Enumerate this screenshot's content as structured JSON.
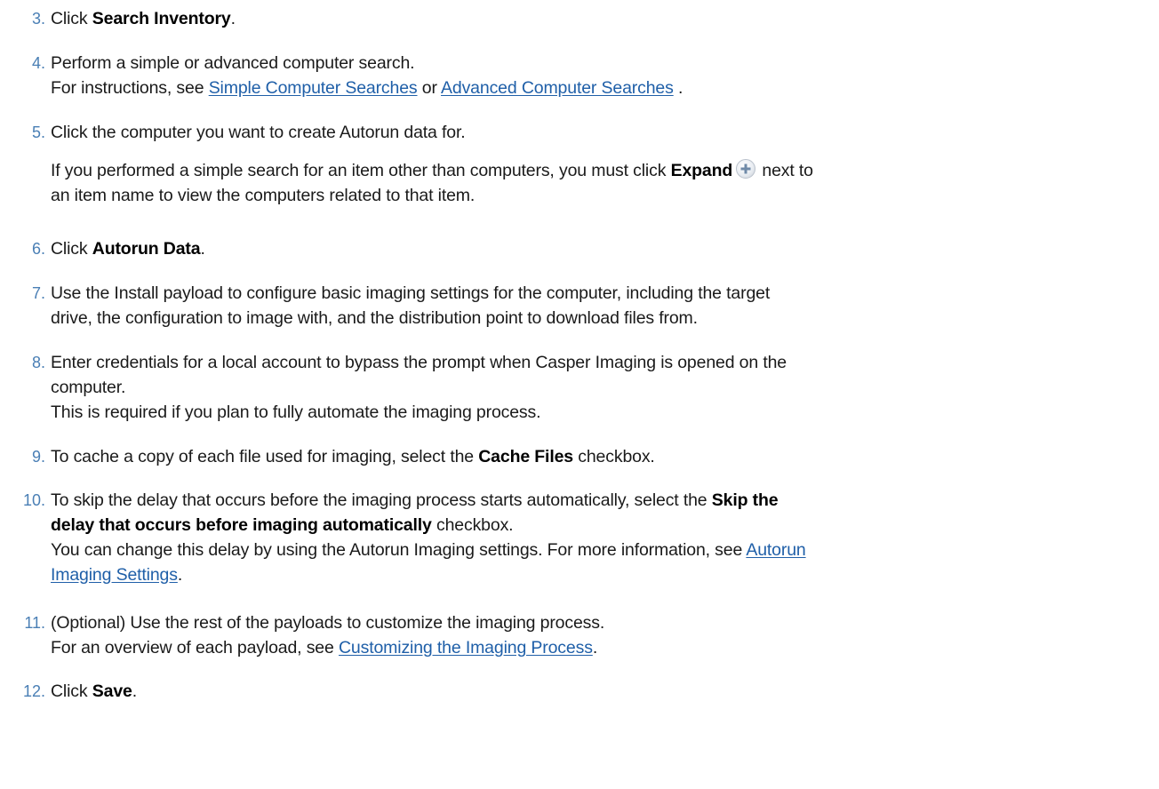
{
  "steps": [
    {
      "num": "3.",
      "pre": "Click ",
      "bold": "Search Inventory",
      "post": "."
    },
    {
      "num": "4.",
      "line1": "Perform a simple or advanced computer search.",
      "line2_pre": "For instructions, see ",
      "link1": "Simple Computer Searches",
      "line2_mid": " or ",
      "link2": "Advanced Computer Searches",
      "line2_post": " ."
    },
    {
      "num": "5.",
      "line1": "Click the computer you want to create Autorun data for.",
      "para_pre": "If you performed a simple search for an item other than computers, you must click ",
      "para_bold": "Expand",
      "para_post_1": " next to",
      "para_post_2": "an item name to view the computers related to that item."
    },
    {
      "num": "6.",
      "pre": "Click ",
      "bold": "Autorun Data",
      "post": "."
    },
    {
      "num": "7.",
      "line1": "Use the Install payload to configure basic imaging settings for the computer, including the target",
      "line2": "drive, the configuration to image with, and the distribution point to download files from."
    },
    {
      "num": "8.",
      "line1": "Enter credentials for a local account to bypass the prompt when Casper Imaging is opened on the",
      "line2": "computer.",
      "line3": "This is required if you plan to fully automate the imaging process."
    },
    {
      "num": "9.",
      "pre": "To cache a copy of each file used for imaging, select the ",
      "bold": "Cache Files",
      "post": " checkbox."
    },
    {
      "num": "10.",
      "line1_pre": "To skip the delay that occurs before the imaging process starts automatically, select the ",
      "line1_bold": "Skip the",
      "line2_bold": "delay that occurs before imaging automatically",
      "line2_post": " checkbox.",
      "line3_pre": "You can change this delay by using the Autorun Imaging settings. For more information, see ",
      "link_a": "Autorun",
      "link_b": "Imaging Settings",
      "line4_post": "."
    },
    {
      "num": "11.",
      "line1": "(Optional) Use the rest of the payloads to customize the imaging process.",
      "line2_pre": "For an overview of each payload, see ",
      "link": "Customizing the Imaging Process",
      "line2_post": "."
    },
    {
      "num": "12.",
      "pre": "Click ",
      "bold": "Save",
      "post": "."
    }
  ],
  "icons": {
    "expand": "plus-circle-icon"
  },
  "colors": {
    "step_number": "#4a7fb5",
    "link": "#1f5fa8",
    "text": "#1a1a1a"
  }
}
